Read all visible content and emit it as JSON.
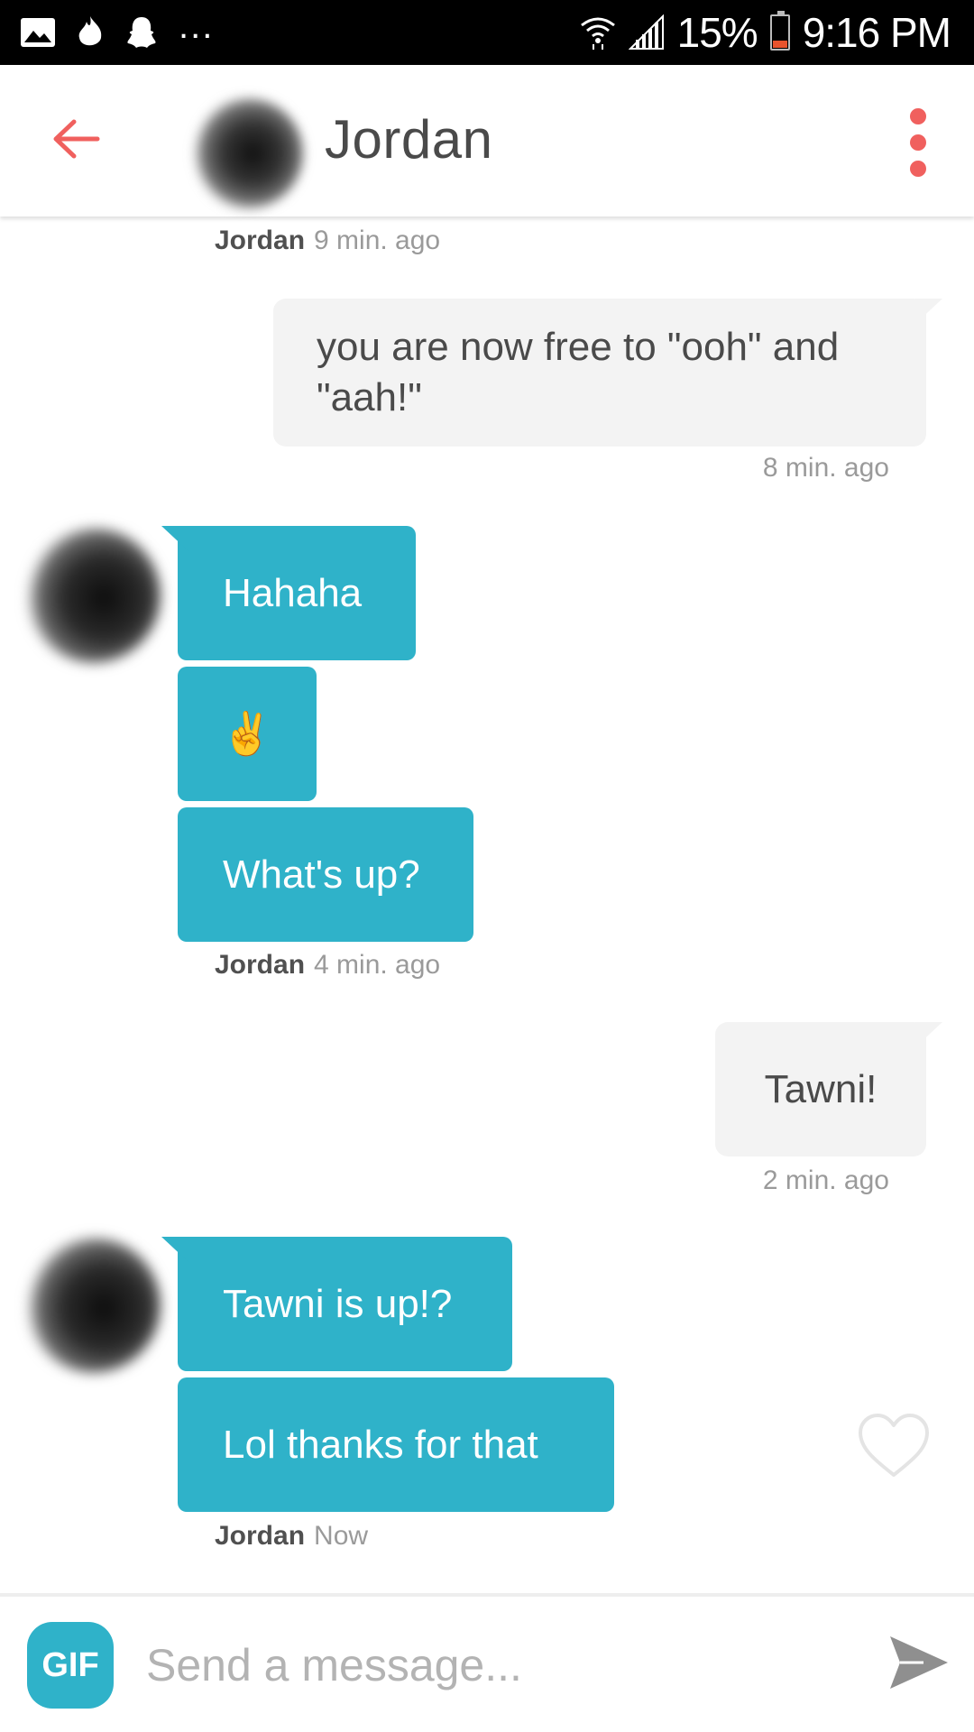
{
  "status_bar": {
    "left_icons": [
      "gallery-icon",
      "tinder-flame-icon",
      "snapchat-ghost-icon"
    ],
    "overflow": "...",
    "battery_percent": "15%",
    "time": "9:16 PM"
  },
  "header": {
    "title": "Jordan",
    "back_icon": "arrow-left-icon",
    "menu_icon": "more-vertical-icon",
    "accent_color": "#f0605e"
  },
  "messages": {
    "meta_1": {
      "sender": "Jordan",
      "time": "9 min. ago"
    },
    "out_1": {
      "text": "you are now free to \"ooh\" and \"aah!\"",
      "time": "8 min. ago"
    },
    "in_1": "Hahaha",
    "in_2": "✌️",
    "in_3": "What's up?",
    "meta_2": {
      "sender": "Jordan",
      "time": "4 min. ago"
    },
    "out_2": {
      "text": "Tawni!",
      "time": "2 min. ago"
    },
    "in_4": "Tawni is up!?",
    "in_5": "Lol thanks for that",
    "meta_3": {
      "sender": "Jordan",
      "time": "Now"
    }
  },
  "colors": {
    "incoming_bubble": "#2fb2c9",
    "outgoing_bubble": "#f3f3f3",
    "gif_button": "#2fb2c9"
  },
  "composer": {
    "gif_label": "GIF",
    "placeholder": "Send a message...",
    "value": "",
    "send_icon": "send-icon"
  }
}
